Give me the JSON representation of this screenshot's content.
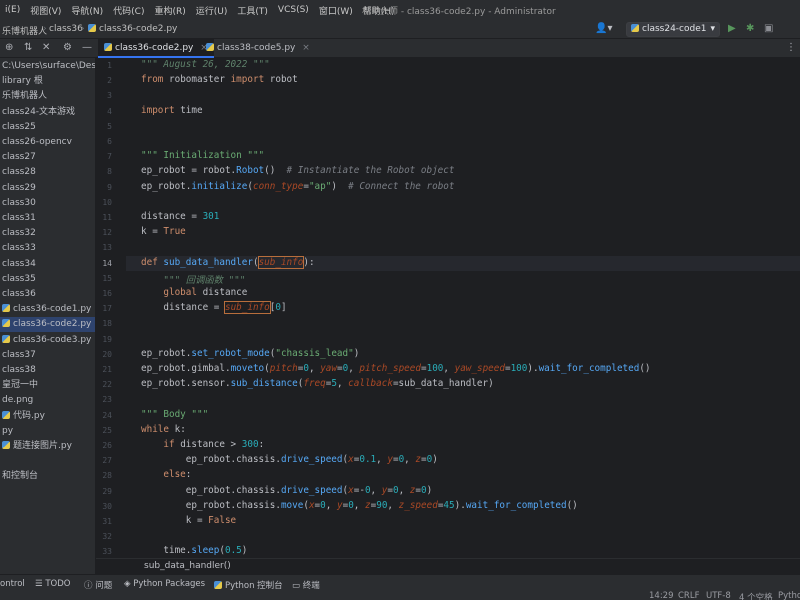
{
  "menu": {
    "items": [
      "i(E)",
      "视图(V)",
      "导航(N)",
      "代码(C)",
      "重构(R)",
      "运行(U)",
      "工具(T)",
      "VCS(S)",
      "窗口(W)",
      "帮助(H)"
    ],
    "window_title": "机甲大师 - class36-code2.py - Administrator"
  },
  "nav": {
    "crumbs": [
      "乐博机器人",
      "class36",
      "class36-code2.py"
    ],
    "run_config": "class24-code1"
  },
  "tabs": [
    {
      "label": "class36-code2.py",
      "active": true
    },
    {
      "label": "class38-code5.py",
      "active": false
    }
  ],
  "tree": [
    {
      "label": "C:\\Users\\surface\\Desk",
      "selected": false
    },
    {
      "label": "library 根",
      "selected": false
    },
    {
      "label": "乐博机器人",
      "selected": false
    },
    {
      "label": "class24-文本游戏",
      "selected": false
    },
    {
      "label": "class25",
      "selected": false
    },
    {
      "label": "class26-opencv",
      "selected": false
    },
    {
      "label": "class27",
      "selected": false
    },
    {
      "label": "class28",
      "selected": false
    },
    {
      "label": "class29",
      "selected": false
    },
    {
      "label": "class30",
      "selected": false
    },
    {
      "label": "class31",
      "selected": false
    },
    {
      "label": "class32",
      "selected": false
    },
    {
      "label": "class33",
      "selected": false
    },
    {
      "label": "class34",
      "selected": false
    },
    {
      "label": "class35",
      "selected": false
    },
    {
      "label": "class36",
      "selected": false
    },
    {
      "label": "class36-code1.py",
      "selected": false
    },
    {
      "label": "class36-code2.py",
      "selected": true
    },
    {
      "label": "class36-code3.py",
      "selected": false
    },
    {
      "label": "class37",
      "selected": false
    },
    {
      "label": "class38",
      "selected": false
    },
    {
      "label": "皇冠一中",
      "selected": false
    },
    {
      "label": "de.png",
      "selected": false
    },
    {
      "label": "代码.py",
      "selected": false
    },
    {
      "label": "py",
      "selected": false
    },
    {
      "label": "题连接图片.py",
      "selected": false
    },
    {
      "label": "",
      "selected": false
    },
    {
      "label": "和控制台",
      "selected": false
    }
  ],
  "editor": {
    "current_line": 14,
    "lines": [
      [
        [
          "doc",
          "\"\"\" August 26, 2022 \"\"\""
        ]
      ],
      [
        [
          "kw",
          "from "
        ],
        [
          "",
          "robomaster "
        ],
        [
          "kw",
          "import "
        ],
        [
          "",
          "robot"
        ]
      ],
      [],
      [
        [
          "kw",
          "import "
        ],
        [
          "",
          "time"
        ]
      ],
      [],
      [],
      [
        [
          "str",
          "\"\"\" Initialization \"\"\""
        ]
      ],
      [
        [
          "",
          "ep_robot = robot."
        ],
        [
          "fn",
          "Robot"
        ],
        [
          "",
          "()  "
        ],
        [
          "cmt",
          "# Instantiate the Robot object"
        ]
      ],
      [
        [
          "",
          "ep_robot."
        ],
        [
          "fn",
          "initialize"
        ],
        [
          "",
          "("
        ],
        [
          "par",
          "conn_type"
        ],
        [
          "",
          "="
        ],
        [
          "str",
          "\"ap\""
        ],
        [
          "",
          ")  "
        ],
        [
          "cmt",
          "# Connect the robot"
        ]
      ],
      [],
      [
        [
          "",
          "distance = "
        ],
        [
          "num",
          "301"
        ]
      ],
      [
        [
          "",
          "k = "
        ],
        [
          "kw",
          "True"
        ]
      ],
      [],
      [
        [
          "kw",
          "def "
        ],
        [
          "fn",
          "sub_data_handler"
        ],
        [
          "",
          "("
        ],
        [
          "box",
          "sub_info"
        ],
        [
          "",
          "):"
        ]
      ],
      [
        [
          "",
          "    "
        ],
        [
          "doc",
          "\"\"\" 回调函数 \"\"\""
        ]
      ],
      [
        [
          "",
          "    "
        ],
        [
          "kw",
          "global "
        ],
        [
          "",
          "distance"
        ]
      ],
      [
        [
          "",
          "    distance = "
        ],
        [
          "box",
          "sub_info"
        ],
        [
          "",
          "["
        ],
        [
          "num",
          "0"
        ],
        [
          "",
          "]"
        ]
      ],
      [],
      [],
      [
        [
          "",
          "ep_robot."
        ],
        [
          "fn",
          "set_robot_mode"
        ],
        [
          "",
          "("
        ],
        [
          "str",
          "\"chassis_lead\""
        ],
        [
          "",
          ")"
        ]
      ],
      [
        [
          "",
          "ep_robot.gimbal."
        ],
        [
          "fn",
          "moveto"
        ],
        [
          "",
          "("
        ],
        [
          "par",
          "pitch"
        ],
        [
          "",
          "="
        ],
        [
          "num",
          "0"
        ],
        [
          "",
          ", "
        ],
        [
          "par",
          "yaw"
        ],
        [
          "",
          "="
        ],
        [
          "num",
          "0"
        ],
        [
          "",
          ", "
        ],
        [
          "par",
          "pitch_speed"
        ],
        [
          "",
          "="
        ],
        [
          "num",
          "100"
        ],
        [
          "",
          ", "
        ],
        [
          "par",
          "yaw_speed"
        ],
        [
          "",
          "="
        ],
        [
          "num",
          "100"
        ],
        [
          "",
          ")."
        ],
        [
          "fn",
          "wait_for_completed"
        ],
        [
          "",
          "()"
        ]
      ],
      [
        [
          "",
          "ep_robot.sensor."
        ],
        [
          "fn",
          "sub_distance"
        ],
        [
          "",
          "("
        ],
        [
          "par",
          "freq"
        ],
        [
          "",
          "="
        ],
        [
          "num",
          "5"
        ],
        [
          "",
          ", "
        ],
        [
          "par",
          "callback"
        ],
        [
          "",
          "=sub_data_handler)"
        ]
      ],
      [],
      [
        [
          "str",
          "\"\"\" Body \"\"\""
        ]
      ],
      [
        [
          "kw",
          "while "
        ],
        [
          "",
          "k:"
        ]
      ],
      [
        [
          "",
          "    "
        ],
        [
          "kw",
          "if "
        ],
        [
          "",
          "distance > "
        ],
        [
          "num",
          "300"
        ],
        [
          "",
          ":"
        ]
      ],
      [
        [
          "",
          "        ep_robot.chassis."
        ],
        [
          "fn",
          "drive_speed"
        ],
        [
          "",
          "("
        ],
        [
          "par",
          "x"
        ],
        [
          "",
          "="
        ],
        [
          "num",
          "0.1"
        ],
        [
          "",
          ", "
        ],
        [
          "par",
          "y"
        ],
        [
          "",
          "="
        ],
        [
          "num",
          "0"
        ],
        [
          "",
          ", "
        ],
        [
          "par",
          "z"
        ],
        [
          "",
          "="
        ],
        [
          "num",
          "0"
        ],
        [
          "",
          ")"
        ]
      ],
      [
        [
          "",
          "    "
        ],
        [
          "kw",
          "else"
        ],
        [
          "",
          ":"
        ]
      ],
      [
        [
          "",
          "        ep_robot.chassis."
        ],
        [
          "fn",
          "drive_speed"
        ],
        [
          "",
          "("
        ],
        [
          "par",
          "x"
        ],
        [
          "",
          "=-"
        ],
        [
          "num",
          "0"
        ],
        [
          "",
          ", "
        ],
        [
          "par",
          "y"
        ],
        [
          "",
          "="
        ],
        [
          "num",
          "0"
        ],
        [
          "",
          ", "
        ],
        [
          "par",
          "z"
        ],
        [
          "",
          "="
        ],
        [
          "num",
          "0"
        ],
        [
          "",
          ")"
        ]
      ],
      [
        [
          "",
          "        ep_robot.chassis."
        ],
        [
          "fn",
          "move"
        ],
        [
          "",
          "("
        ],
        [
          "par",
          "x"
        ],
        [
          "",
          "="
        ],
        [
          "num",
          "0"
        ],
        [
          "",
          ", "
        ],
        [
          "par",
          "y"
        ],
        [
          "",
          "="
        ],
        [
          "num",
          "0"
        ],
        [
          "",
          ", "
        ],
        [
          "par",
          "z"
        ],
        [
          "",
          "="
        ],
        [
          "num",
          "90"
        ],
        [
          "",
          ", "
        ],
        [
          "par",
          "z_speed"
        ],
        [
          "",
          "="
        ],
        [
          "num",
          "45"
        ],
        [
          "",
          ")."
        ],
        [
          "fn",
          "wait_for_completed"
        ],
        [
          "",
          "()"
        ]
      ],
      [
        [
          "",
          "        k = "
        ],
        [
          "kw",
          "False"
        ]
      ],
      [],
      [
        [
          "",
          "    time."
        ],
        [
          "fn",
          "sleep"
        ],
        [
          "",
          "("
        ],
        [
          "num",
          "0.5"
        ],
        [
          "",
          ")"
        ]
      ]
    ]
  },
  "code_breadcrumb": "sub_data_handler()",
  "bottom_tools": [
    "ontrol",
    "TODO",
    "问题",
    "Python Packages",
    "Python 控制台",
    "终端"
  ],
  "status": [
    "14:29",
    "CRLF",
    "UTF-8",
    "4 个空格",
    "Pytho"
  ],
  "icons": {
    "settings": "gear-icon",
    "run": "play-icon",
    "debug": "bug-icon",
    "search": "search-icon",
    "user": "user-icon"
  }
}
